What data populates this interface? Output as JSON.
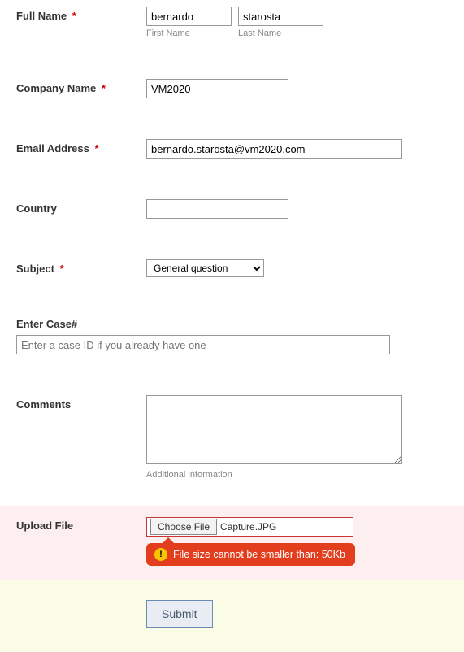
{
  "fullName": {
    "label": "Full Name",
    "required": "*",
    "firstValue": "bernardo",
    "firstSub": "First Name",
    "lastValue": "starosta",
    "lastSub": "Last Name"
  },
  "company": {
    "label": "Company Name",
    "required": "*",
    "value": "VM2020"
  },
  "email": {
    "label": "Email Address",
    "required": "*",
    "value": "bernardo.starosta@vm2020.com"
  },
  "country": {
    "label": "Country",
    "value": ""
  },
  "subject": {
    "label": "Subject",
    "required": "*",
    "selected": "General question"
  },
  "caseField": {
    "label": "Enter Case#",
    "placeholder": "Enter a case ID if you already have one"
  },
  "comments": {
    "label": "Comments",
    "value": "",
    "sub": "Additional information"
  },
  "upload": {
    "label": "Upload File",
    "button": "Choose File",
    "filename": "Capture.JPG",
    "error": "File size cannot be smaller than: 50Kb",
    "errorIcon": "!"
  },
  "submit": {
    "label": "Submit"
  }
}
